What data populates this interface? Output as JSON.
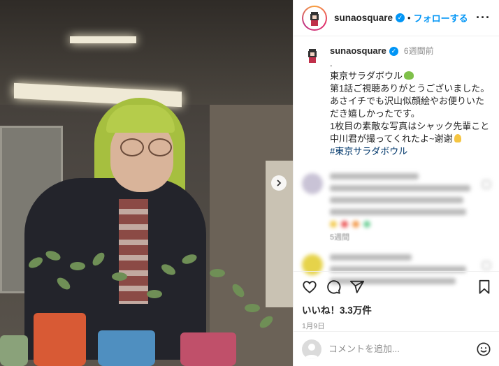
{
  "post": {
    "username": "sunaosquare",
    "follow_label": "フォローする",
    "separator": "•",
    "more_label": "···",
    "verified_mark": "✓"
  },
  "caption": {
    "username": "sunaosquare",
    "time": "6週間前",
    "lines": [
      ".",
      "東京サラダボウル",
      "第1話ご視聴ありがとうございました。",
      "あさイチでも沢山似顔絵やお便りいた",
      "だき嬉しかったです。",
      "1枚目の素敵な写真はシャック先輩こと",
      "中川君が撮ってくれたよ~谢谢"
    ],
    "hashtag": "#東京サラダボウル"
  },
  "blurred_comments": [
    {
      "meta": "5週間"
    }
  ],
  "stats": {
    "likes": "いいね！3.3万件",
    "date": "1月9日"
  },
  "comment_input": {
    "placeholder": "コメントを追加..."
  },
  "icons": {
    "like": "heart-icon",
    "comment": "comment-icon",
    "share": "share-icon",
    "save": "bookmark-icon",
    "emoji": "smiley-icon",
    "next": "chevron-right-icon"
  },
  "colors": {
    "accent": "#0095f6",
    "hashtag": "#00376b",
    "muted": "#8e8e8e",
    "text": "#262626"
  }
}
